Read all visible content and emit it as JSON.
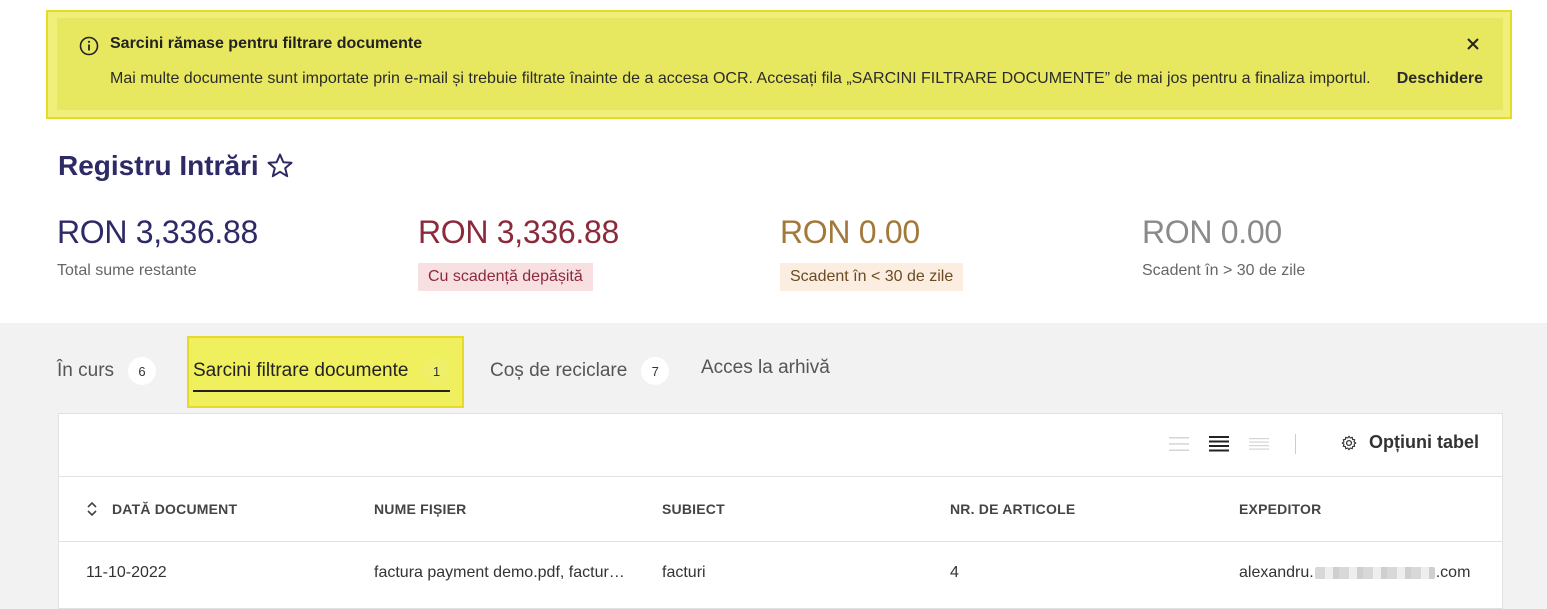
{
  "banner": {
    "title": "Sarcini rămase pentru filtrare documente",
    "message": "Mai multe documente sunt importate prin e-mail și trebuie filtrate înainte de a accesa OCR. Accesați fila „SARCINI FILTRARE DOCUMENTE” de mai jos pentru a finaliza importul.",
    "open_label": "Deschidere",
    "info_icon": "info-icon",
    "close_icon": "close-icon",
    "color": "#e8e860"
  },
  "page": {
    "title": "Registru Intrări",
    "favorite_icon": "star-icon"
  },
  "summary": [
    {
      "amount": "RON 3,336.88",
      "label": "Total sume restante"
    },
    {
      "amount": "RON 3,336.88",
      "label": "Cu scadență depășită"
    },
    {
      "amount": "RON 0.00",
      "label": "Scadent în < 30 de zile"
    },
    {
      "amount": "RON 0.00",
      "label": "Scadent în > 30 de zile"
    }
  ],
  "tabs": [
    {
      "label": "În curs",
      "count": "6"
    },
    {
      "label": "Sarcini filtrare documente",
      "count": "1",
      "active": true
    },
    {
      "label": "Coș de reciclare",
      "count": "7"
    },
    {
      "label": "Acces la arhivă"
    }
  ],
  "toolbar": {
    "density_icons": [
      "density-compact-icon",
      "density-normal-icon",
      "density-comfortable-icon"
    ],
    "table_options_label": "Opțiuni tabel",
    "table_options_icon": "gear-icon"
  },
  "table": {
    "columns": [
      "DATĂ DOCUMENT",
      "NUME FIȘIER",
      "SUBIECT",
      "NR. DE ARTICOLE",
      "EXPEDITOR"
    ],
    "rows": [
      {
        "date": "11-10-2022",
        "filename": "factura payment demo.pdf, factur…",
        "subject": "facturi",
        "items": "4",
        "sender_prefix": "alexandru.",
        "sender_suffix": ".com"
      }
    ]
  }
}
